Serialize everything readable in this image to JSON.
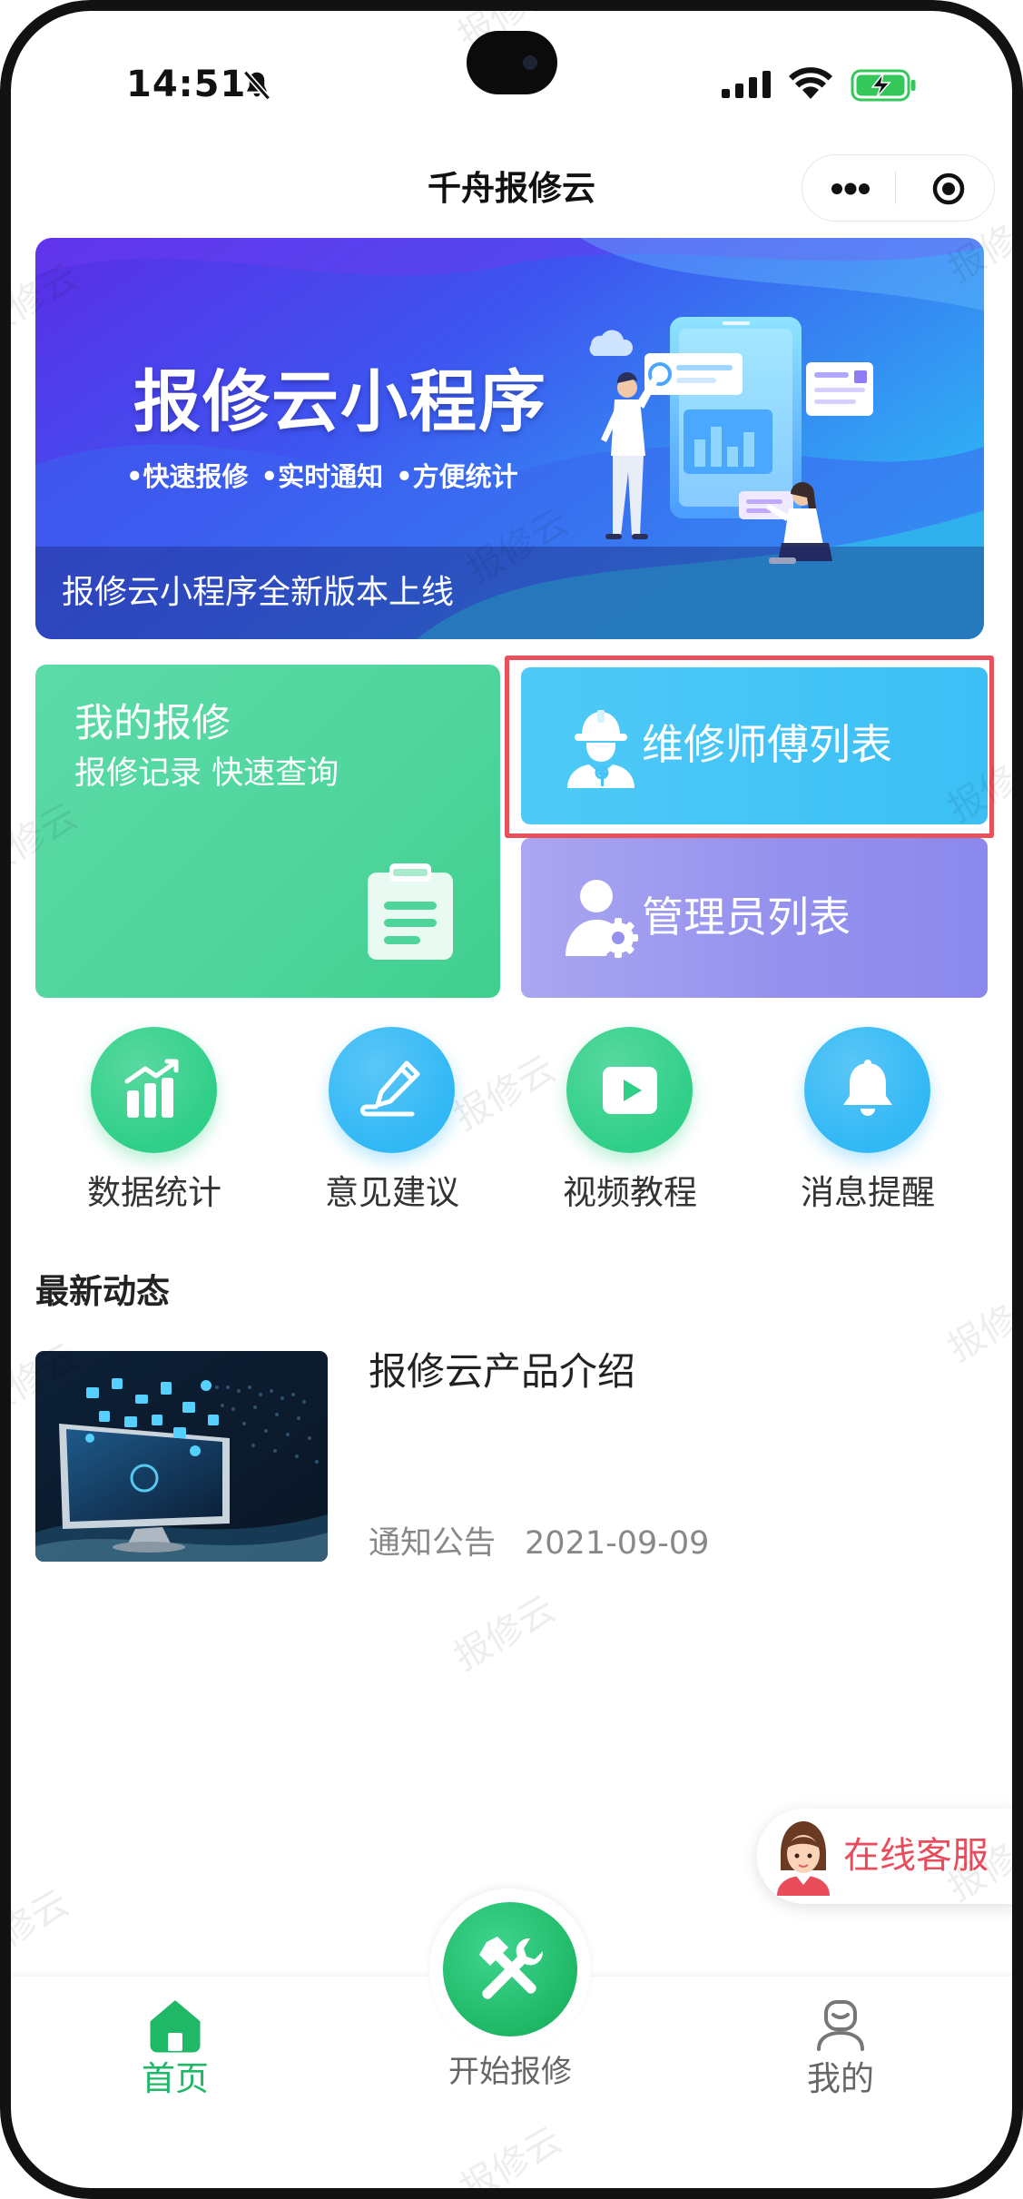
{
  "status_bar": {
    "time": "14:51",
    "icons": [
      "bell-muted-icon",
      "cellular-signal-icon",
      "wifi-icon",
      "battery-charging-icon"
    ]
  },
  "nav": {
    "title": "千舟报修云",
    "menu_icon": "more-dots-icon",
    "close_icon": "target-icon"
  },
  "banner": {
    "title": "报修云小程序",
    "features": [
      "•快速报修",
      "•实时通知",
      "•方便统计"
    ],
    "caption": "报修云小程序全新版本上线"
  },
  "cards": {
    "my_repairs": {
      "title": "我的报修",
      "subtitle": "报修记录 快速查询",
      "icon": "clipboard-icon"
    },
    "technicians": {
      "label": "维修师傅列表",
      "icon": "worker-icon",
      "highlighted": true
    },
    "admins": {
      "label": "管理员列表",
      "icon": "admin-gear-icon"
    }
  },
  "shortcuts": [
    {
      "label": "数据统计",
      "icon": "bar-chart-icon",
      "color": "#2fcf88"
    },
    {
      "label": "意见建议",
      "icon": "pen-icon",
      "color": "#31b8f5"
    },
    {
      "label": "视频教程",
      "icon": "play-icon",
      "color": "#2fcf88"
    },
    {
      "label": "消息提醒",
      "icon": "bell-icon",
      "color": "#31b8f5"
    }
  ],
  "news": {
    "heading": "最新动态",
    "items": [
      {
        "title": "报修云产品介绍",
        "category": "通知公告",
        "date": "2021-09-09",
        "thumbnail": "computer-monitor-image"
      }
    ]
  },
  "service": {
    "label": "在线客服",
    "icon": "agent-avatar-icon"
  },
  "tabbar": {
    "items": [
      {
        "label": "首页",
        "icon": "home-icon",
        "active": true
      },
      {
        "label": "开始报修",
        "icon": "wrench-hammer-icon",
        "active": false
      },
      {
        "label": "我的",
        "icon": "user-icon",
        "active": false
      }
    ]
  },
  "watermark": {
    "text": "报修云"
  },
  "colors": {
    "accent_green": "#1fb866",
    "card_green": "#4fd59c",
    "card_blue": "#3bbff5",
    "card_purple": "#9592ee",
    "highlight_red": "#e8505b",
    "service_red": "#e94d5c"
  }
}
